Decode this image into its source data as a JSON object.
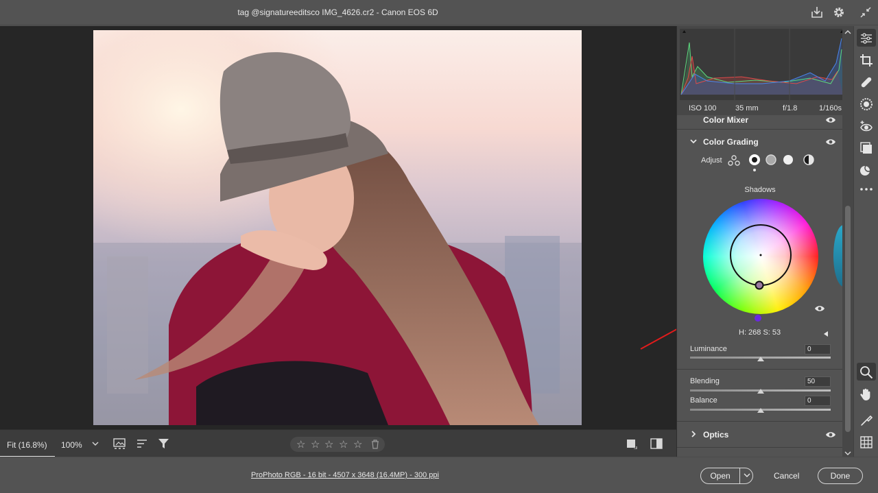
{
  "window": {
    "title": "tag @signatureeditsco IMG_4626.cr2  -  Canon EOS 6D"
  },
  "camera_info": {
    "iso": "ISO 100",
    "focal_length": "35 mm",
    "aperture": "f/1.8",
    "shutter": "1/160s"
  },
  "panel": {
    "prev_section": "Color Mixer",
    "color_grading": {
      "title": "Color Grading",
      "adjust_label": "Adjust",
      "shadows_label": "Shadows",
      "hs_readout": "H: 268  S: 53",
      "hue": 268,
      "saturation": 53
    },
    "sliders": [
      {
        "label": "Luminance",
        "value": "0",
        "position": 0.5
      },
      {
        "label": "Blending",
        "value": "50",
        "position": 0.5
      },
      {
        "label": "Balance",
        "value": "0",
        "position": 0.5
      }
    ],
    "optics_title": "Optics"
  },
  "bottom_toolbar": {
    "zoom_fit": "Fit (16.8%)",
    "zoom_100": "100%"
  },
  "status_bar": {
    "file_info": "ProPhoto RGB - 16 bit - 4507 x 3648 (16.4MP) - 300 ppi",
    "open_label": "Open",
    "cancel_label": "Cancel",
    "done_label": "Done"
  },
  "colors": {
    "accent_arrow": "#e21b1b",
    "panel_bg": "#535353",
    "canvas_bg": "#262626"
  }
}
